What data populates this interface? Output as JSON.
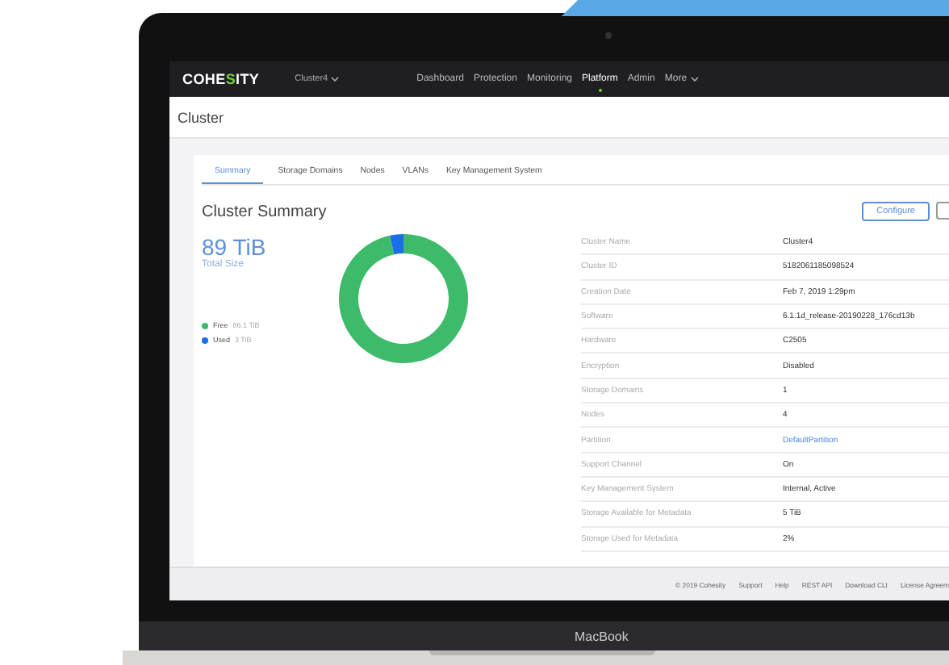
{
  "app_bar": {
    "logo": "COHESITY",
    "cluster": "Cluster4",
    "nav": [
      {
        "label": "Dashboard",
        "selected": false
      },
      {
        "label": "Protection",
        "selected": false
      },
      {
        "label": "Monitoring",
        "selected": false
      },
      {
        "label": "Platform",
        "selected": true
      },
      {
        "label": "Admin",
        "selected": false
      },
      {
        "label": "More",
        "selected": false
      }
    ]
  },
  "page_title": "Cluster",
  "tabs": [
    {
      "label": "Summary",
      "selected": true
    },
    {
      "label": "Storage Domains",
      "selected": false
    },
    {
      "label": "Nodes",
      "selected": false
    },
    {
      "label": "VLANs",
      "selected": false
    },
    {
      "label": "Key Management System",
      "selected": false
    }
  ],
  "summary": {
    "title": "Cluster Summary",
    "button": "Configure",
    "total": "89 TiB",
    "legend": [
      {
        "value": "86.1 TiB",
        "color": "#3dbb6b"
      },
      {
        "value": "3 TiB",
        "color": "#1a6ee8"
      }
    ],
    "chart_data": {
      "type": "donut",
      "categories": [
        "Free",
        "Used"
      ],
      "series": [
        {
          "name": "Total Size",
          "values": [
            96.63,
            3.37
          ]
        }
      ]
    }
  },
  "details": [
    {
      "label": "Cluster Name",
      "value": "Cluster4",
      "kind": "text"
    },
    {
      "label": "Cluster ID",
      "value": "5182061185098524",
      "kind": "text"
    },
    {
      "label": "Creation Date",
      "value": "Feb 7, 2019 1:29pm",
      "kind": "text"
    },
    {
      "label": "Software",
      "value": "6.1.1d_release-20190228_176cd13b",
      "kind": "text"
    },
    {
      "label": "Hardware",
      "value": "C2505",
      "kind": "text"
    },
    {
      "label": "Encryption",
      "value": "Disabled",
      "kind": "text"
    },
    {
      "label": "Storage Domains",
      "value": "1",
      "kind": "text"
    },
    {
      "label": "Nodes",
      "value": "4",
      "kind": "text"
    },
    {
      "label": "Partition",
      "value": "DefaultPartition",
      "kind": "link"
    },
    {
      "label": "Support Channel",
      "value": "On",
      "kind": "text"
    },
    {
      "label": "Key Management System",
      "value": "Internal, Active",
      "kind": "text"
    },
    {
      "label": "Storage Available for Metadata",
      "value": "5 TiB",
      "kind": "text"
    },
    {
      "label": "Storage Used for Metadata",
      "value": "2%",
      "kind": "text"
    }
  ],
  "footer": [
    "© 2019 Cohesity",
    "Support",
    "Help",
    "REST API",
    "Download CLI",
    "License Agreem"
  ],
  "device_label": "MacBook"
}
